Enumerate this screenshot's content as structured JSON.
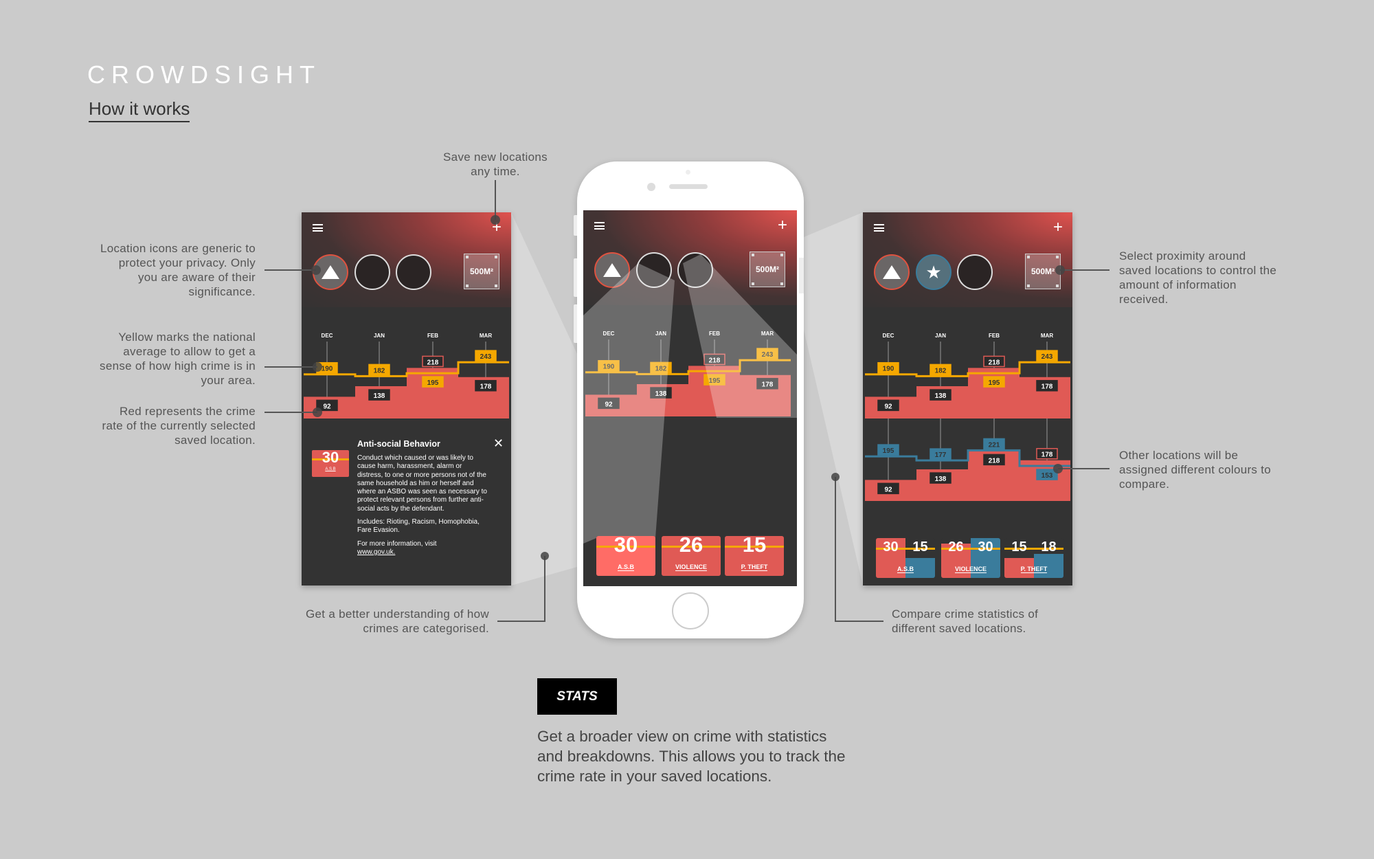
{
  "brand": {
    "logo": "CROWDSIGHT",
    "subtitle": "How it works"
  },
  "colors": {
    "background": "#cbcbcb",
    "screen": "#333333",
    "red": "#e05a55",
    "yellow": "#f5a800",
    "blue": "#3a7c9c"
  },
  "annotations": {
    "location_icons": "Location icons are generic to protect your privacy. Only you are aware of their significance.",
    "yellow": "Yellow marks the national average to allow to get a sense of how high crime is in your area.",
    "red": "Red represents the crime rate of the currently selected saved location.",
    "save": "Save new locations any time.",
    "categorised": "Get a better understanding of how crimes are categorised.",
    "proximity": "Select proximity around saved locations to control the amount of information received.",
    "other_colours": "Other locations will be assigned different colours to compare.",
    "compare": "Compare crime statistics of different saved locations."
  },
  "section": {
    "badge": "STATS",
    "description": "Get a broader view on crime with statistics and breakdowns. This allows you to track the crime rate in your saved locations."
  },
  "screens": [
    {
      "area": "500M²",
      "menu_icon": "hamburger-icon",
      "add_icon": "plus-icon",
      "circles": [
        {
          "icon": "triangle",
          "state": "active"
        },
        {
          "icon": "none",
          "state": "empty"
        },
        {
          "icon": "none",
          "state": "empty"
        }
      ],
      "chart": {
        "months": [
          "DEC",
          "JAN",
          "FEB",
          "MAR"
        ],
        "location": [
          92,
          138,
          218,
          178
        ],
        "national": [
          190,
          182,
          195,
          243
        ]
      },
      "info": {
        "tile_value": "30",
        "tile_label": "A.S.B",
        "title": "Anti-social Behavior",
        "body": "Conduct which caused or was likely to cause harm, harassment, alarm or distress, to one or more persons not of the same household as him or herself and where an ASBO was seen as necessary to protect relevant persons from further anti-social acts by the defendant.",
        "includes": "Includes: Rioting, Racism, Homophobia, Fare Evasion.",
        "more": "For more information, visit",
        "link": "www.gov.uk."
      }
    },
    {
      "area": "500M²",
      "menu_icon": "hamburger-icon",
      "add_icon": "plus-icon",
      "circles": [
        {
          "icon": "triangle",
          "state": "active"
        },
        {
          "icon": "none",
          "state": "empty"
        },
        {
          "icon": "none",
          "state": "empty"
        }
      ],
      "chart": {
        "months": [
          "DEC",
          "JAN",
          "FEB",
          "MAR"
        ],
        "location": [
          92,
          138,
          218,
          178
        ],
        "national": [
          190,
          182,
          195,
          243
        ]
      },
      "tiles": [
        {
          "values": [
            "30"
          ],
          "label": "A.S.B"
        },
        {
          "values": [
            "26"
          ],
          "label": "VIOLENCE"
        },
        {
          "values": [
            "15"
          ],
          "label": "P. THEFT"
        }
      ]
    },
    {
      "area": "500M²",
      "menu_icon": "hamburger-icon",
      "add_icon": "plus-icon",
      "circles": [
        {
          "icon": "triangle",
          "state": "active"
        },
        {
          "icon": "star",
          "state": "blue"
        },
        {
          "icon": "none",
          "state": "empty"
        }
      ],
      "chart": {
        "months": [
          "DEC",
          "JAN",
          "FEB",
          "MAR"
        ],
        "location": [
          92,
          138,
          218,
          178
        ],
        "national": [
          190,
          182,
          195,
          243
        ]
      },
      "compare_chart": {
        "location": [
          92,
          138,
          218,
          178
        ],
        "other": [
          195,
          177,
          221,
          153
        ]
      },
      "tiles": [
        {
          "values": [
            "30",
            "15"
          ],
          "label": "A.S.B"
        },
        {
          "values": [
            "26",
            "30"
          ],
          "label": "VIOLENCE"
        },
        {
          "values": [
            "15",
            "18"
          ],
          "label": "P. THEFT"
        }
      ]
    }
  ]
}
